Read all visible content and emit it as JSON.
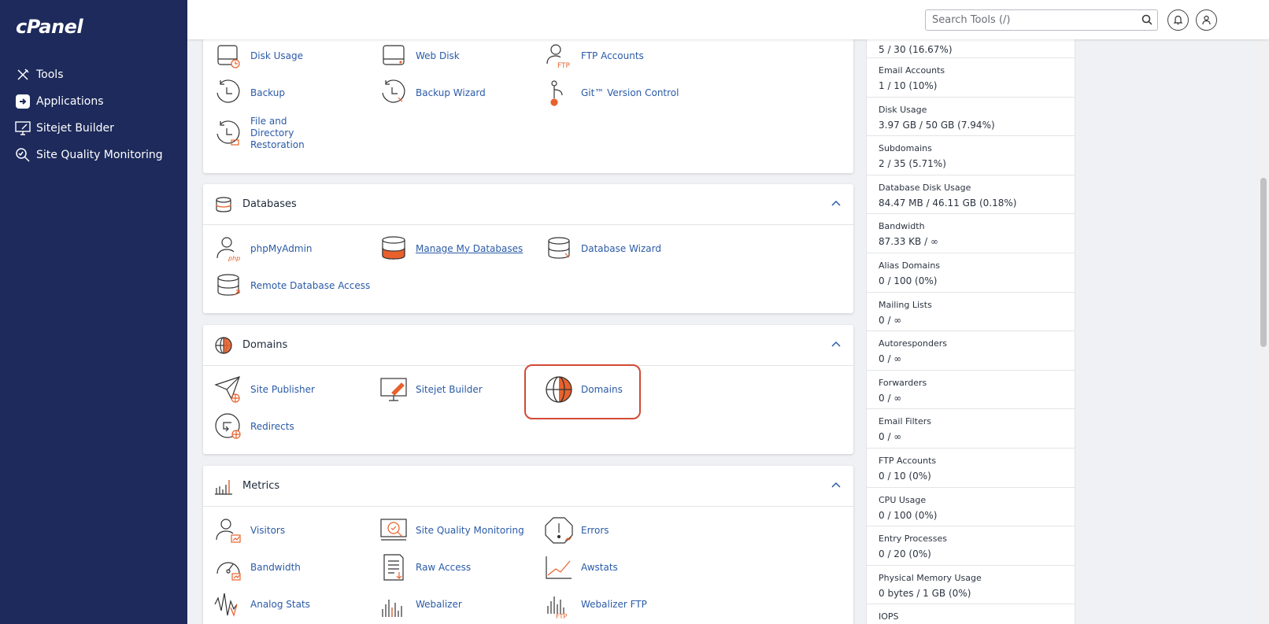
{
  "sidebar": {
    "logo": "cPanel",
    "items": [
      {
        "label": "Tools",
        "icon": "tools-icon"
      },
      {
        "label": "Applications",
        "icon": "applications-icon"
      },
      {
        "label": "Sitejet Builder",
        "icon": "sitejet-builder-icon"
      },
      {
        "label": "Site Quality Monitoring",
        "icon": "site-quality-monitoring-icon"
      }
    ]
  },
  "topbar": {
    "search_placeholder": "Search Tools (/)"
  },
  "files_section": {
    "items": [
      "Disk Usage",
      "Web Disk",
      "FTP Accounts",
      "Backup",
      "Backup Wizard",
      "Git™ Version Control",
      "File and Directory Restoration"
    ]
  },
  "databases_section": {
    "title": "Databases",
    "items": [
      "phpMyAdmin",
      "Manage My Databases",
      "Database Wizard",
      "Remote Database Access"
    ]
  },
  "domains_section": {
    "title": "Domains",
    "items": [
      "Site Publisher",
      "Sitejet Builder",
      "Domains",
      "Redirects"
    ]
  },
  "metrics_section": {
    "title": "Metrics",
    "items": [
      "Visitors",
      "Site Quality Monitoring",
      "Errors",
      "Bandwidth",
      "Raw Access",
      "Awstats",
      "Analog Stats",
      "Webalizer",
      "Webalizer FTP"
    ]
  },
  "stats": [
    {
      "label": "",
      "value": "5 / 30   (16.67%)"
    },
    {
      "label": "Email Accounts",
      "value": "1 / 10   (10%)"
    },
    {
      "label": "Disk Usage",
      "value": "3.97 GB / 50 GB   (7.94%)"
    },
    {
      "label": "Subdomains",
      "value": "2 / 35   (5.71%)"
    },
    {
      "label": "Database Disk Usage",
      "value": "84.47 MB / 46.11 GB   (0.18%)"
    },
    {
      "label": "Bandwidth",
      "value": "87.33 KB / ∞"
    },
    {
      "label": "Alias Domains",
      "value": "0 / 100   (0%)"
    },
    {
      "label": "Mailing Lists",
      "value": "0 / ∞"
    },
    {
      "label": "Autoresponders",
      "value": "0 / ∞"
    },
    {
      "label": "Forwarders",
      "value": "0 / ∞"
    },
    {
      "label": "Email Filters",
      "value": "0 / ∞"
    },
    {
      "label": "FTP Accounts",
      "value": "0 / 10   (0%)"
    },
    {
      "label": "CPU Usage",
      "value": "0 / 100   (0%)"
    },
    {
      "label": "Entry Processes",
      "value": "0 / 20   (0%)"
    },
    {
      "label": "Physical Memory Usage",
      "value": "0 bytes / 1 GB   (0%)"
    },
    {
      "label": "IOPS",
      "value": ""
    }
  ],
  "colors": {
    "sidebar": "#1d2a5b",
    "link": "#2a5aa7",
    "accent": "#e8612c",
    "highlight": "#d24a36"
  }
}
